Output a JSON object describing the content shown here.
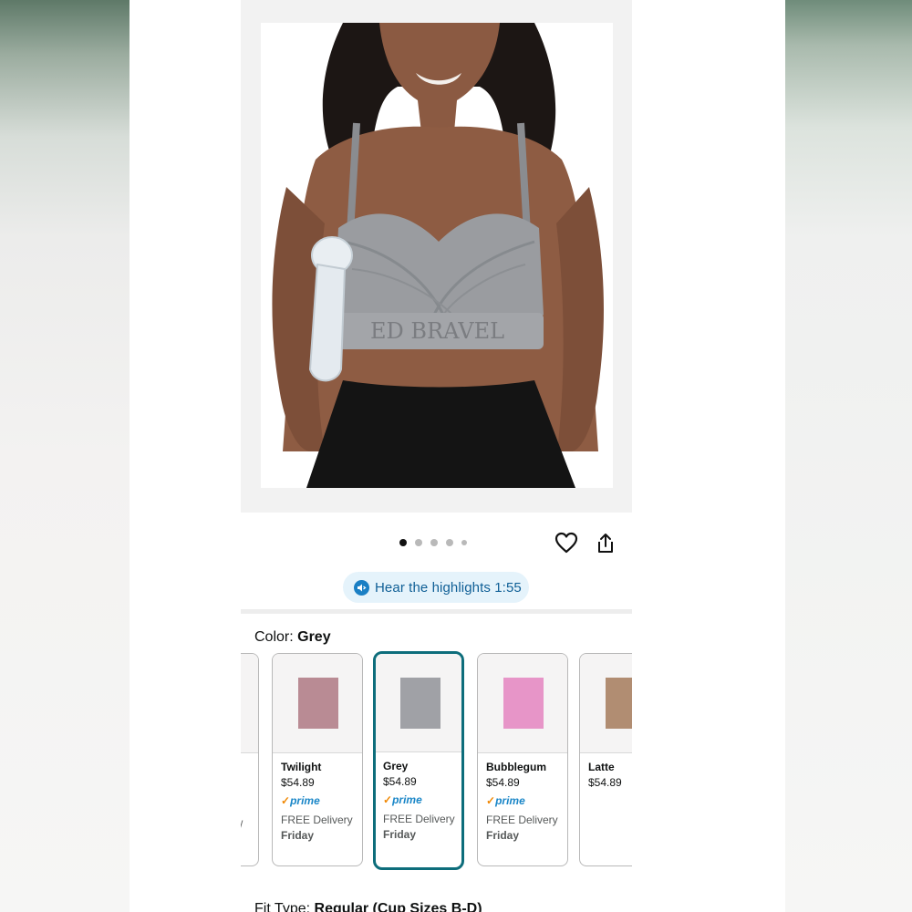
{
  "carousel": {
    "total_images": 5,
    "active_index": 0
  },
  "actions": {
    "favorite_icon": "heart-icon",
    "share_icon": "share-icon"
  },
  "audio": {
    "label": "Hear the highlights 1:55",
    "icon": "speaker-icon"
  },
  "color_selector": {
    "label": "Color: ",
    "selected": "Grey",
    "options": [
      {
        "name": "",
        "price": "",
        "prime": "",
        "delivery": "",
        "day": "",
        "swatch": "#f2eef0",
        "partial": "/"
      },
      {
        "name": "Twilight",
        "price": "$54.89",
        "prime": "prime",
        "delivery": "FREE Delivery",
        "day": "Friday",
        "swatch": "#b98b94"
      },
      {
        "name": "Grey",
        "price": "$54.89",
        "prime": "prime",
        "delivery": "FREE Delivery",
        "day": "Friday",
        "swatch": "#a0a1a6"
      },
      {
        "name": "Bubblegum",
        "price": "$54.89",
        "prime": "prime",
        "delivery": "FREE Delivery",
        "day": "Friday",
        "swatch": "#e795c8"
      },
      {
        "name": "Latte",
        "price": "$54.89",
        "prime": "",
        "delivery": "",
        "day": "",
        "swatch": "#b18d72"
      }
    ]
  },
  "fit_type": {
    "label": "Fit Type: ",
    "value": "Regular (Cup Sizes B-D)"
  },
  "colors": {
    "accent": "#0d6d7b",
    "link": "#1a86c7",
    "pill_bg": "#e5f3fb"
  }
}
